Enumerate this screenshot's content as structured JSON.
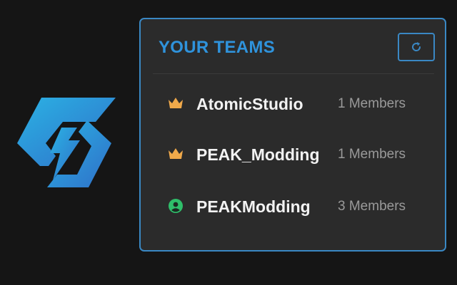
{
  "panel": {
    "title": "YOUR TEAMS",
    "refresh_icon": "refresh-icon"
  },
  "teams": [
    {
      "name": "AtomicStudio",
      "members": "1 Members",
      "role_icon": "crown-icon"
    },
    {
      "name": "PEAK_Modding",
      "members": "1 Members",
      "role_icon": "crown-icon"
    },
    {
      "name": "PEAKModding",
      "members": "3 Members",
      "role_icon": "user-circle-icon"
    }
  ],
  "logo": {
    "icon": "thunderstore-logo-icon"
  },
  "colors": {
    "accent": "#3a88c4",
    "title": "#2f93dc",
    "crown": "#f0a94a",
    "member": "#2fbf6a",
    "panel_bg": "#2b2b2b",
    "page_bg": "#151515"
  }
}
